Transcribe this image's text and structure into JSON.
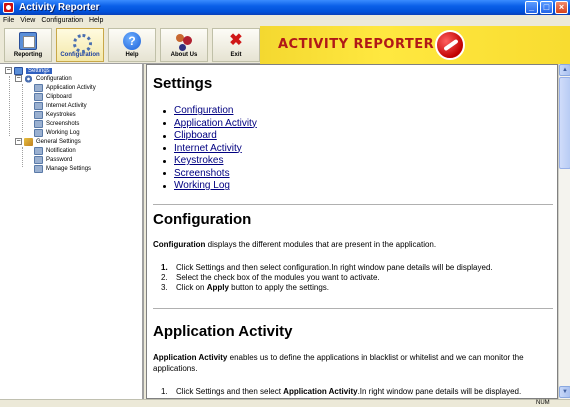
{
  "window": {
    "title": "Activity Reporter"
  },
  "menu": [
    "File",
    "View",
    "Configuration",
    "Help"
  ],
  "toolbar": {
    "buttons": [
      {
        "label": "Reporting",
        "icon": "reporting-icon"
      },
      {
        "label": "Configuration",
        "icon": "configuration-icon",
        "active": true
      },
      {
        "label": "Help",
        "icon": "help-icon"
      },
      {
        "label": "About Us",
        "icon": "about-us-icon"
      },
      {
        "label": "Exit",
        "icon": "exit-icon"
      }
    ],
    "help_glyph": "?",
    "exit_glyph": "✖"
  },
  "banner": {
    "title": "ACTIVITY REPORTER"
  },
  "tree": {
    "root": "Settings",
    "configuration": "Configuration",
    "config_items": [
      "Application Activity",
      "Clipboard",
      "Internet Activity",
      "Keystrokes",
      "Screenshots",
      "Working Log"
    ],
    "general": "General Settings",
    "general_items": [
      "Notification",
      "Password",
      "Manage Settings"
    ]
  },
  "content": {
    "title": "Settings",
    "links": [
      "Configuration",
      "Application Activity",
      "Clipboard",
      "Internet Activity",
      "Keystrokes",
      "Screenshots",
      "Working Log"
    ],
    "sec1": {
      "heading": "Configuration",
      "intro_bold": "Configuration",
      "intro_rest": " displays the different modules that are present in the application.",
      "step1": "Click Settings and then select configuration.In right window pane details will be displayed.",
      "step2": "Select the check box of the modules you want to activate.",
      "step3_pre": "Click on ",
      "step3_bold": "Apply",
      "step3_post": " button to apply the settings."
    },
    "sec2": {
      "heading": "Application Activity",
      "intro_bold": "Application Activity",
      "intro_rest": " enables us to define the applications in blacklist or whitelist and we can monitor the applications.",
      "step1_pre": "Click Settings and then select ",
      "step1_bold": "Application Activity",
      "step1_post": ".In right window pane details will be displayed."
    }
  },
  "status": {
    "num": "NUM"
  },
  "colors": {
    "accent": "#0a5fe8",
    "banner": "#ffe840",
    "banner_text": "#b01818",
    "link": "#000080"
  }
}
